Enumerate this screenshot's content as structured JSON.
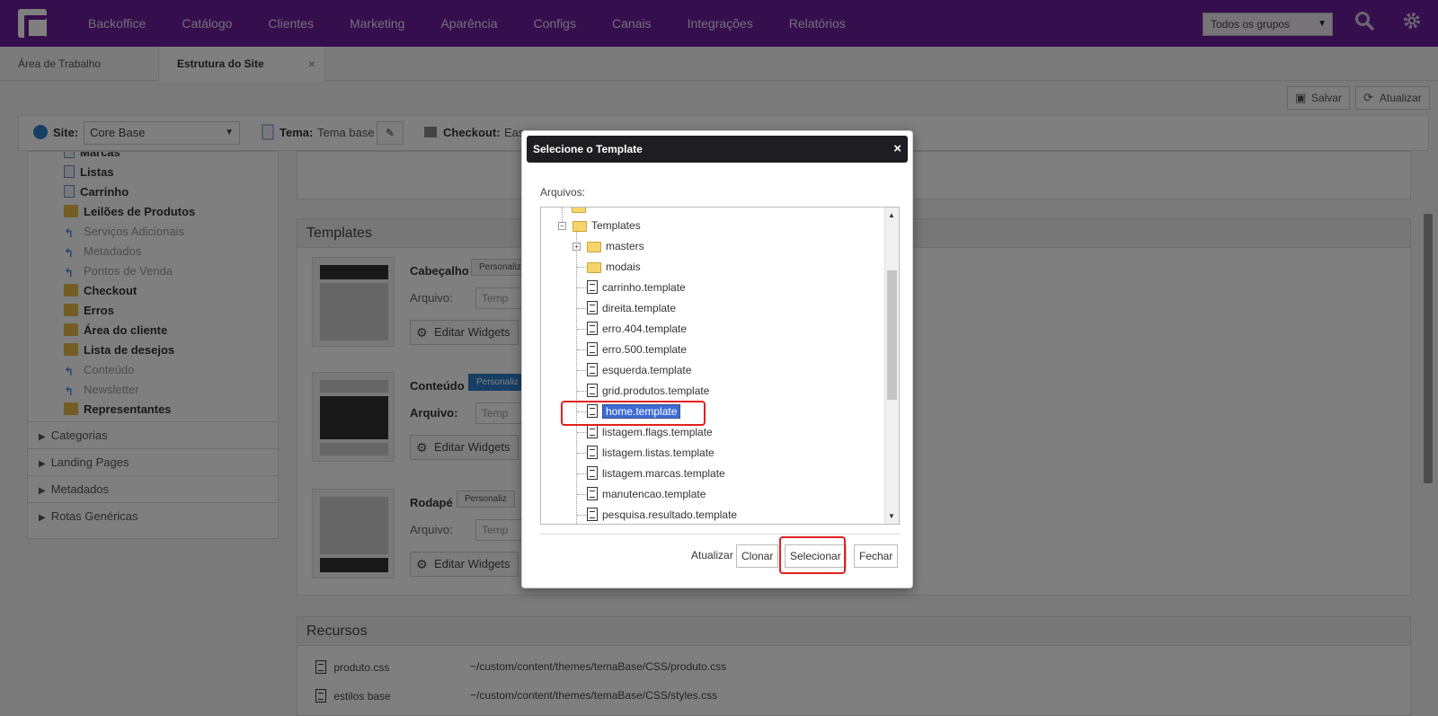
{
  "nav": {
    "items": [
      "Backoffice",
      "Catálogo",
      "Clientes",
      "Marketing",
      "Aparência",
      "Configs",
      "Canais",
      "Integrações",
      "Relatórios"
    ],
    "group_select": "Todos os grupos",
    "search_icon": "search-icon",
    "gear_icon": "gear-icon"
  },
  "tabs": {
    "desktop": "Área de Trabalho",
    "site_structure": "Estrutura do Site",
    "close": "×"
  },
  "actions": {
    "save": "Salvar",
    "refresh": "Atualizar"
  },
  "sitebar": {
    "site_label": "Site:",
    "site_value": "Core Base",
    "theme_label": "Tema:",
    "theme_value": "Tema base",
    "checkout_label": "Checkout:",
    "checkout_value": "Eas"
  },
  "tree": {
    "items": [
      {
        "label": "Marcas",
        "style": "bold",
        "icon": "page"
      },
      {
        "label": "Listas",
        "style": "bold",
        "icon": "page"
      },
      {
        "label": "Carrinho",
        "style": "bold",
        "icon": "page"
      },
      {
        "label": "Leilões de Produtos",
        "style": "bold",
        "icon": "folder"
      },
      {
        "label": "Serviços Adicionais",
        "style": "light",
        "icon": "arrow"
      },
      {
        "label": "Metadados",
        "style": "light",
        "icon": "arrow"
      },
      {
        "label": "Pontos de Venda",
        "style": "light",
        "icon": "arrow"
      },
      {
        "label": "Checkout",
        "style": "bold",
        "icon": "folder"
      },
      {
        "label": "Erros",
        "style": "bold",
        "icon": "folder"
      },
      {
        "label": "Área do cliente",
        "style": "bold",
        "icon": "folder"
      },
      {
        "label": "Lista de desejos",
        "style": "bold",
        "icon": "folder"
      },
      {
        "label": "Conteúdo",
        "style": "light",
        "icon": "arrow"
      },
      {
        "label": "Newsletter",
        "style": "light",
        "icon": "arrow"
      },
      {
        "label": "Representantes",
        "style": "bold",
        "icon": "folder"
      }
    ],
    "accordions": [
      "Categorias",
      "Landing Pages",
      "Metadados",
      "Rotas Genéricas"
    ]
  },
  "templates": {
    "title": "Templates",
    "header_label": "Cabeçalho",
    "content_label": "Conteúdo",
    "footer_label": "Rodapé",
    "file_label": "Arquivo:",
    "customize": "Personaliz",
    "file_placeholder": "Temp",
    "edit_widgets": "Editar Widgets"
  },
  "resources": {
    "title": "Recursos",
    "rows": [
      {
        "name": "produto.css",
        "path": "~/custom/content/themes/temaBase/CSS/produto.css"
      },
      {
        "name": "estilos base",
        "path": "~/custom/content/themes/temaBase/CSS/styles.css"
      }
    ]
  },
  "modal": {
    "title": "Selecione o Template",
    "close": "×",
    "files_label": "Arquivos:",
    "top_folder": "Templates",
    "folders": [
      "masters",
      "modais"
    ],
    "files": [
      "carrinho.template",
      "direita.template",
      "erro.404.template",
      "erro.500.template",
      "esquerda.template",
      "grid.produtos.template",
      "home.template",
      "listagem.flags.template",
      "listagem.listas.template",
      "listagem.marcas.template",
      "manutencao.template",
      "pesquisa.resultado.template"
    ],
    "selected_file": "home.template",
    "buttons": {
      "refresh": "Atualizar",
      "clone": "Clonar",
      "select": "Selecionar",
      "close": "Fechar"
    }
  },
  "colors": {
    "nav_bg": "#6b1f9b",
    "modal_head": "#1e1e22",
    "highlight": "#e02020",
    "selection": "#3d6bd6"
  }
}
